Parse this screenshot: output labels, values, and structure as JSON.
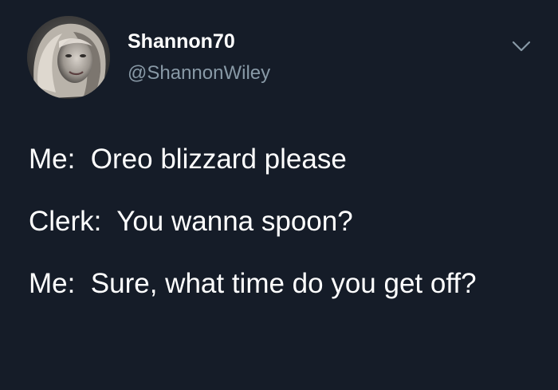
{
  "user": {
    "display_name": "Shannon70",
    "handle": "@ShannonWiley"
  },
  "icons": {
    "menu": "chevron-down-icon",
    "avatar": "profile-photo"
  },
  "colors": {
    "background": "#151c28",
    "text": "#ffffff",
    "secondary_text": "#8899a6"
  },
  "tweet": {
    "lines": [
      "Me:  Oreo blizzard please",
      "Clerk:  You wanna spoon?",
      "Me:  Sure, what time do you get off?"
    ]
  }
}
